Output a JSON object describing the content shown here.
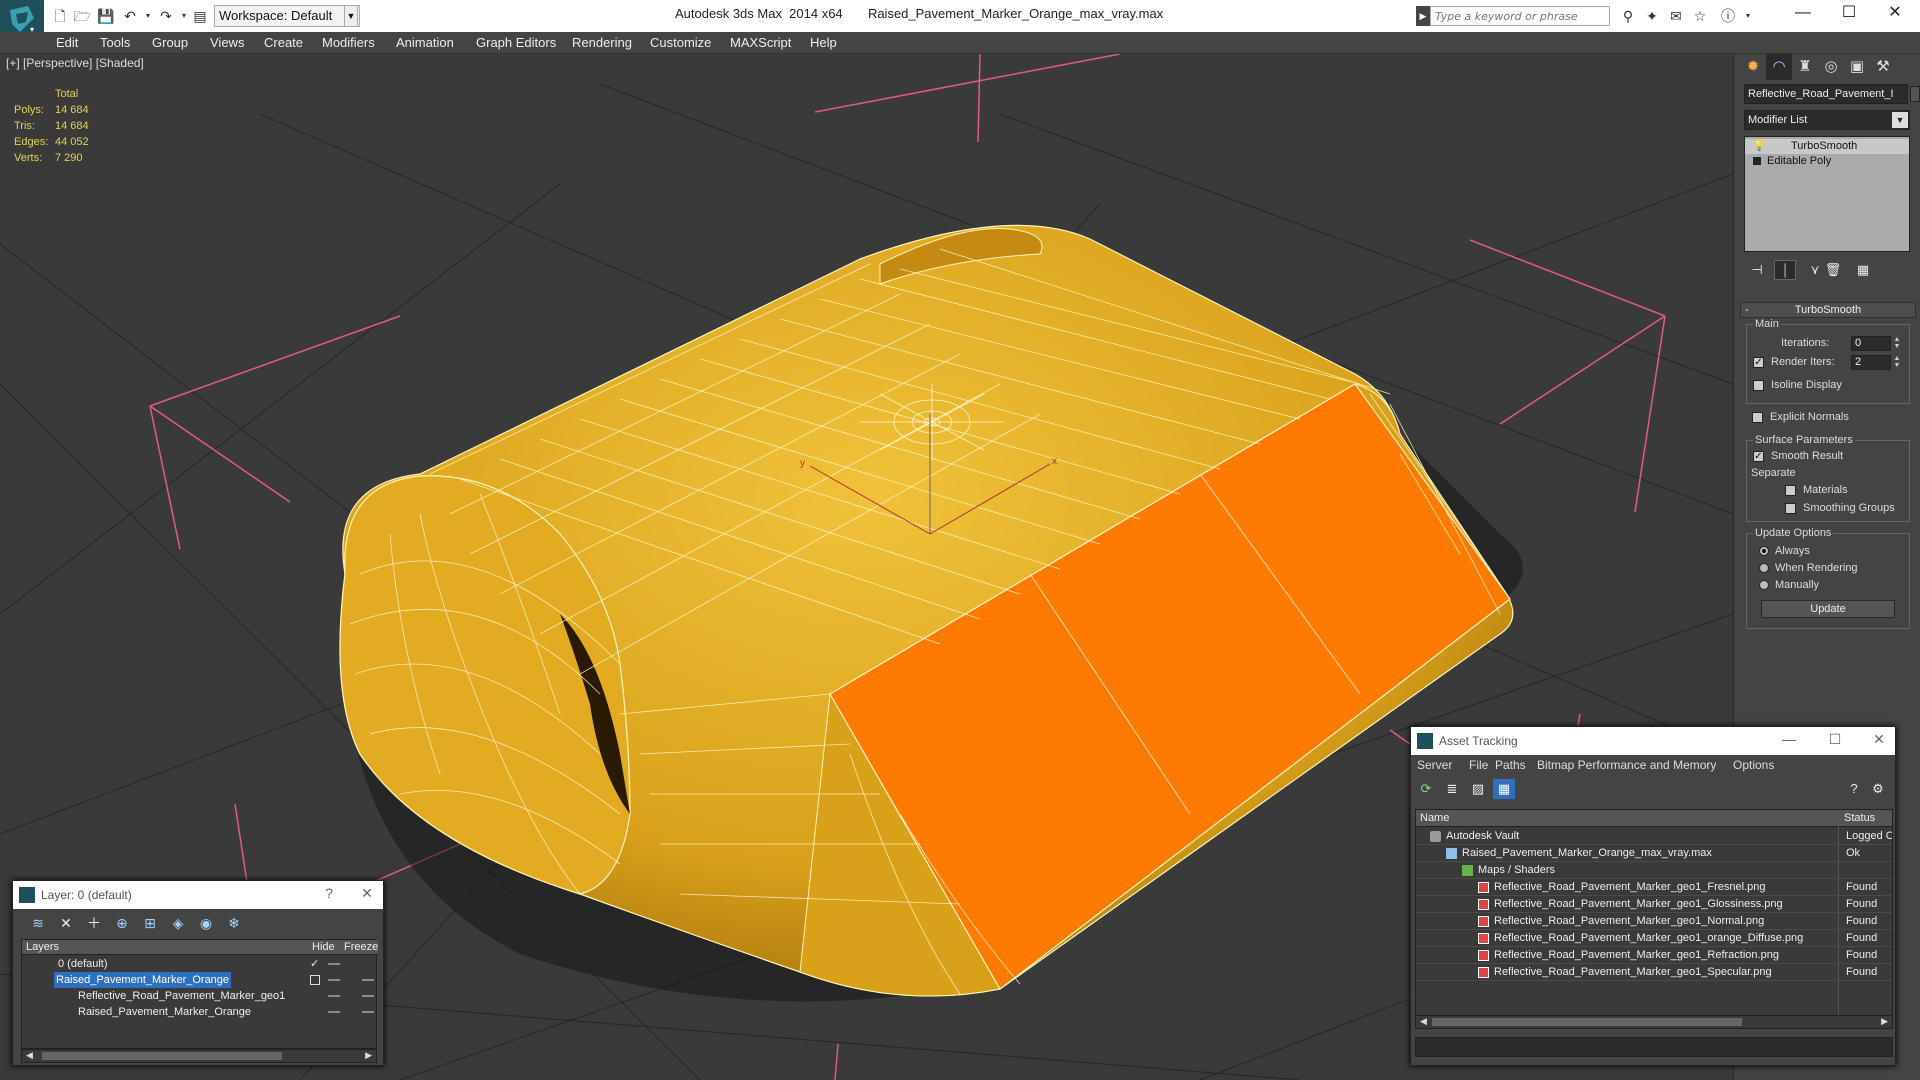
{
  "app": {
    "window_title": "Autodesk 3ds Max  2014 x64       Raised_Pavement_Marker_Orange_max_vray.max",
    "workspace": "Workspace: Default",
    "search_placeholder": "Type a keyword or phrase"
  },
  "menu": [
    "Edit",
    "Tools",
    "Group",
    "Views",
    "Create",
    "Modifiers",
    "Animation",
    "Graph Editors",
    "Rendering",
    "Customize",
    "MAXScript",
    "Help"
  ],
  "viewport": {
    "label": "[+] [Perspective] [Shaded]",
    "stats": {
      "header": "Total",
      "rows": [
        {
          "k": "Polys:",
          "v": "14 684"
        },
        {
          "k": "Tris:",
          "v": "14 684"
        },
        {
          "k": "Edges:",
          "v": "44 052"
        },
        {
          "k": "Verts:",
          "v": "7 290"
        }
      ]
    },
    "axis_x": "x",
    "axis_y": "y",
    "colors": {
      "body": "#e0a81a",
      "reflector": "#ff7a00",
      "wire": "#fff6c8",
      "grid": "#1e1e1e",
      "bbox": "#e05a8a"
    }
  },
  "command_panel": {
    "object_name": "Reflective_Road_Pavement_I",
    "modifier_list": "Modifier List",
    "stack": [
      "TurboSmooth",
      "Editable Poly"
    ],
    "rollout_title": "TurboSmooth",
    "main_group": "Main",
    "iterations_label": "Iterations:",
    "iterations_value": "0",
    "render_iters_label": "Render Iters:",
    "render_iters_value": "2",
    "isoline_label": "Isoline Display",
    "explicit_normals_label": "Explicit Normals",
    "surface_group": "Surface Parameters",
    "smooth_result_label": "Smooth Result",
    "separate_label": "Separate",
    "materials_label": "Materials",
    "smoothing_groups_label": "Smoothing Groups",
    "update_group": "Update Options",
    "always_label": "Always",
    "when_rendering_label": "When Rendering",
    "manually_label": "Manually",
    "update_button": "Update"
  },
  "layer_dialog": {
    "title": "Layer: 0 (default)",
    "help": "?",
    "close": "✕",
    "col_layers": "Layers",
    "col_hide": "Hide",
    "col_freeze": "Freeze",
    "rows": [
      {
        "name": "0 (default)"
      },
      {
        "name": "Raised_Pavement_Marker_Orange"
      },
      {
        "name": "Reflective_Road_Pavement_Marker_geo1"
      },
      {
        "name": "Raised_Pavement_Marker_Orange"
      }
    ]
  },
  "asset_dialog": {
    "title": "Asset Tracking",
    "menu": [
      "Server",
      "File",
      "Paths",
      "Bitmap Performance and Memory",
      "Options"
    ],
    "col_name": "Name",
    "col_status": "Status",
    "rows": [
      {
        "name": "Autodesk Vault",
        "status": "Logged O"
      },
      {
        "name": "Raised_Pavement_Marker_Orange_max_vray.max",
        "status": "Ok"
      },
      {
        "name": "Maps / Shaders",
        "status": ""
      },
      {
        "name": "Reflective_Road_Pavement_Marker_geo1_Fresnel.png",
        "status": "Found"
      },
      {
        "name": "Reflective_Road_Pavement_Marker_geo1_Glossiness.png",
        "status": "Found"
      },
      {
        "name": "Reflective_Road_Pavement_Marker_geo1_Normal.png",
        "status": "Found"
      },
      {
        "name": "Reflective_Road_Pavement_Marker_geo1_orange_Diffuse.png",
        "status": "Found"
      },
      {
        "name": "Reflective_Road_Pavement_Marker_geo1_Refraction.png",
        "status": "Found"
      },
      {
        "name": "Reflective_Road_Pavement_Marker_geo1_Specular.png",
        "status": "Found"
      }
    ]
  }
}
